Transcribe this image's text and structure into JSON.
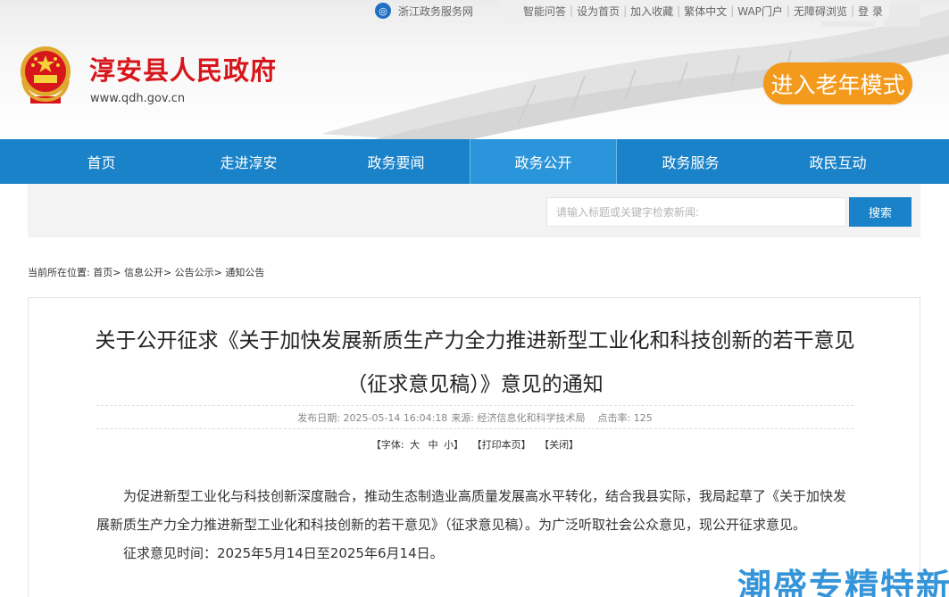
{
  "topbar": {
    "zj_icon": "zhejiang-service-icon",
    "zj_label": "浙江政务服务网",
    "links": [
      "智能问答",
      "设为首页",
      "加入收藏",
      "繁体中文",
      "WAP门户",
      "无障碍浏览",
      "登 录"
    ]
  },
  "site": {
    "title": "淳安县人民政府",
    "url": "www.qdh.gov.cn",
    "elder_mode": "进入老年模式"
  },
  "nav": {
    "items": [
      "首页",
      "走进淳安",
      "政务要闻",
      "政务公开",
      "政务服务",
      "政民互动"
    ],
    "active_index": 3
  },
  "search": {
    "placeholder": "请输入标题或关键字检索新闻:",
    "button": "搜索"
  },
  "breadcrumb": {
    "prefix": "当前所在位置:",
    "items": [
      "首页",
      "信息公开",
      "公告公示",
      "通知公告"
    ]
  },
  "article": {
    "title": "关于公开征求《关于加快发展新质生产力全力推进新型工业化和科技创新的若干意见（征求意见稿）》意见的通知",
    "meta_date": "发布日期:  2025-05-14 16:04:18",
    "meta_source": "来源:  经济信息化和科学技术局",
    "meta_clicks": "点击率:   125",
    "tools": {
      "font_label": "【字体:",
      "font_big": "大",
      "font_mid": "中",
      "font_small": "小】",
      "print": "【打印本页】",
      "close": "【关闭】"
    },
    "paragraphs": [
      "为促进新型工业化与科技创新深度融合，推动生态制造业高质量发展高水平转化，结合我县实际，我局起草了《关于加快发展新质生产力全力推进新型工业化和科技创新的若干意见》（征求意见稿）。为广泛听取社会公众意见，现公开征求意见。",
      "征求意见时间：2025年5月14日至2025年6月14日。"
    ]
  },
  "watermark": "潮盛专精特新",
  "colors": {
    "brand_red": "#d7161c",
    "nav_blue": "#1a82c8",
    "elder_orange": "#f39a1d"
  }
}
